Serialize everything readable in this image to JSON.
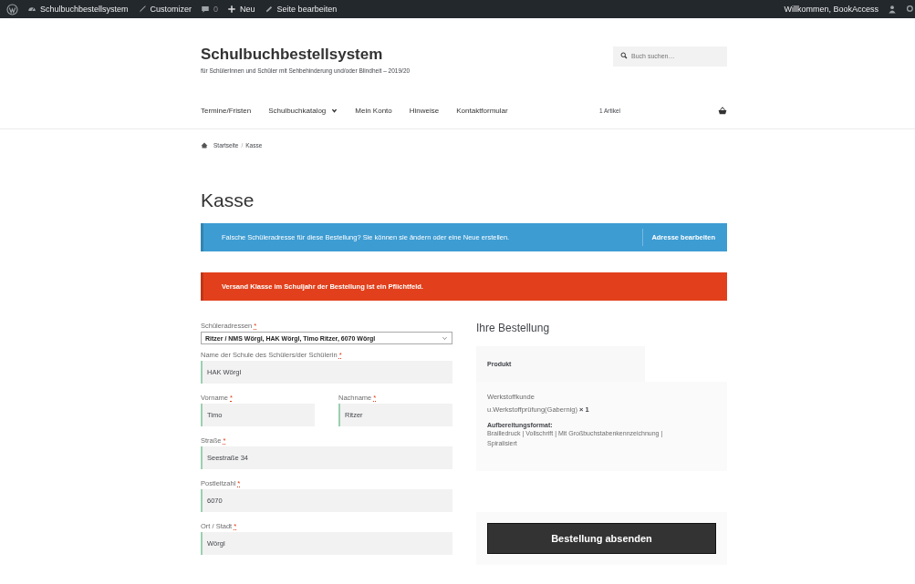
{
  "admin_bar": {
    "items": [
      {
        "kind": "logo"
      },
      {
        "kind": "site",
        "label": "Schulbuchbestellsystem"
      },
      {
        "kind": "brush",
        "label": "Customizer"
      },
      {
        "kind": "comments",
        "label": "0"
      },
      {
        "kind": "new",
        "label": "Neu"
      },
      {
        "kind": "edit",
        "label": "Seite bearbeiten"
      }
    ],
    "greeting": "Willkommen, BookAccess"
  },
  "site": {
    "title": "Schulbuchbestellsystem",
    "tagline": "für SchülerInnen und Schüler mit Sehbehinderung und/oder Blindheit – 2019/20"
  },
  "search": {
    "placeholder": "Buch suchen…"
  },
  "nav": [
    {
      "label": "Termine/Fristen",
      "has_submenu": false
    },
    {
      "label": "Schulbuchkatalog",
      "has_submenu": true
    },
    {
      "label": "Mein Konto",
      "has_submenu": false
    },
    {
      "label": "Hinweise",
      "has_submenu": false
    },
    {
      "label": "Kontaktformular",
      "has_submenu": false
    }
  ],
  "cart": {
    "count": "1 Artikel"
  },
  "breadcrumb": [
    "Startseite",
    "Kasse"
  ],
  "breadcrumb_separator": "/",
  "page_title": "Kasse",
  "notices": [
    {
      "kind": "info",
      "text": "Falsche Schüleradresse für diese Bestellung? Sie können sie ändern oder eine Neue erstellen.",
      "action": "Adresse bearbeiten"
    },
    {
      "kind": "error",
      "text": "Versand Klasse im Schuljahr der Bestellung ist ein Pflichtfeld."
    }
  ],
  "form": {
    "fields": [
      {
        "kind": "select",
        "label": "Schüleradressen",
        "marker": "*",
        "value": "Ritzer / NMS Wörgl, HAK Wörgl, Timo Ritzer, 6070 Wörgl",
        "half": false
      },
      {
        "kind": "text",
        "label": "Name der Schule des Schülers/der Schülerin",
        "marker": "*",
        "value": "HAK Wörgl",
        "half": false
      },
      {
        "kind": "text",
        "label": "Vorname",
        "marker": "*",
        "value": "Timo",
        "half": true
      },
      {
        "kind": "text",
        "label": "Nachname",
        "marker": "*",
        "value": "Ritzer",
        "half": true
      },
      {
        "kind": "text",
        "label": "Straße",
        "marker": "*",
        "value": "Seestraße 34",
        "half": false
      },
      {
        "kind": "text",
        "label": "Postleitzahl",
        "marker": "*",
        "value": "6070",
        "half": false
      },
      {
        "kind": "text",
        "label": "Ort / Stadt",
        "marker": "*",
        "value": "Wörgl",
        "half": false
      }
    ]
  },
  "order": {
    "title": "Ihre Bestellung",
    "column": "Produkt",
    "item": {
      "name": "Werkstoffkunde u.Werkstoffprüfung(Gabernig)",
      "quantity": "× 1",
      "meta_label": "Aufbereitungsformat:",
      "meta_value": "Brailledruck | Vollschrift | Mit Großbuchstabenkennzeichnung | Spiralisiert"
    },
    "submit": "Bestellung absenden"
  }
}
